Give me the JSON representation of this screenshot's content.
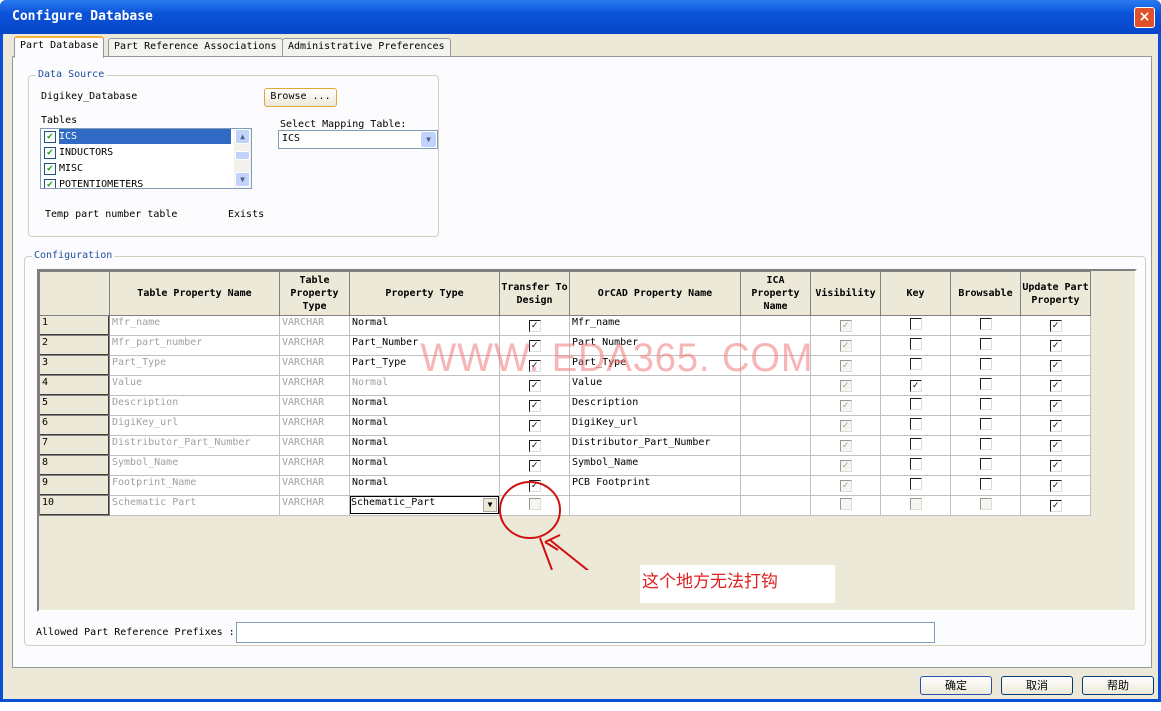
{
  "window": {
    "title": "Configure Database",
    "close": "×"
  },
  "tabs": [
    "Part Database",
    "Part Reference Associations",
    "Administrative Preferences"
  ],
  "data_source": {
    "label": "Data Source",
    "db_name": "Digikey_Database",
    "browse": "Browse ...",
    "tables_label": "Tables",
    "tables": [
      {
        "name": "ICS",
        "checked": true,
        "selected": true
      },
      {
        "name": "INDUCTORS",
        "checked": true
      },
      {
        "name": "MISC",
        "checked": true
      },
      {
        "name": "POTENTIOMETERS",
        "checked": true
      }
    ],
    "mapping_label": "Select Mapping Table:",
    "mapping_value": "ICS",
    "temp_label": "Temp part number table",
    "temp_status": "Exists"
  },
  "configuration": {
    "label": "Configuration",
    "columns": [
      "",
      "Table Property Name",
      "Table Property Type",
      "Property Type",
      "Transfer To Design",
      "OrCAD Property Name",
      "ICA Property Name",
      "Visibility",
      "Key",
      "Browsable",
      "Update Part Property"
    ],
    "rows": [
      {
        "n": "1",
        "name": "Mfr_name",
        "type": "VARCHAR",
        "ptype": "Normal",
        "transfer": true,
        "orcad": "Mfr_name",
        "ica": "",
        "vis": true,
        "key": false,
        "brows": false,
        "update": true
      },
      {
        "n": "2",
        "name": "Mfr_part_number",
        "type": "VARCHAR",
        "ptype": "Part_Number",
        "transfer": true,
        "orcad": "Part Number",
        "ica": "",
        "vis": true,
        "key": false,
        "brows": false,
        "update": true
      },
      {
        "n": "3",
        "name": "Part_Type",
        "type": "VARCHAR",
        "ptype": "Part_Type",
        "transfer": true,
        "orcad": "Part_Type",
        "ica": "",
        "vis": true,
        "key": false,
        "brows": false,
        "update": true
      },
      {
        "n": "4",
        "name": "Value",
        "type": "VARCHAR",
        "ptype": "Normal",
        "ptype_dim": true,
        "transfer": true,
        "orcad": "Value",
        "ica": "",
        "vis": true,
        "key": true,
        "brows": false,
        "update": true
      },
      {
        "n": "5",
        "name": "Description",
        "type": "VARCHAR",
        "ptype": "Normal",
        "transfer": true,
        "orcad": "Description",
        "ica": "",
        "vis": true,
        "key": false,
        "brows": false,
        "update": true
      },
      {
        "n": "6",
        "name": "DigiKey_url",
        "type": "VARCHAR",
        "ptype": "Normal",
        "transfer": true,
        "orcad": "DigiKey_url",
        "ica": "",
        "vis": true,
        "key": false,
        "brows": false,
        "update": true
      },
      {
        "n": "7",
        "name": "Distributor_Part_Number",
        "type": "VARCHAR",
        "ptype": "Normal",
        "transfer": true,
        "orcad": "Distributor_Part_Number",
        "ica": "",
        "vis": true,
        "key": false,
        "brows": false,
        "update": true
      },
      {
        "n": "8",
        "name": "Symbol_Name",
        "type": "VARCHAR",
        "ptype": "Normal",
        "transfer": true,
        "orcad": "Symbol_Name",
        "ica": "",
        "vis": true,
        "key": false,
        "brows": false,
        "update": true
      },
      {
        "n": "9",
        "name": "Footprint_Name",
        "type": "VARCHAR",
        "ptype": "Normal",
        "transfer": true,
        "orcad": "PCB Footprint",
        "ica": "",
        "vis": true,
        "key": false,
        "brows": false,
        "update": true
      },
      {
        "n": "10",
        "name": "Schematic Part",
        "type": "VARCHAR",
        "ptype": "Schematic_Part",
        "ptype_dropdown": true,
        "transfer": false,
        "transfer_disabled": true,
        "orcad": "",
        "ica": "",
        "vis": false,
        "key": false,
        "brows": false,
        "update": true
      }
    ],
    "prefix_label": "Allowed Part Reference Prefixes :",
    "prefix_value": ""
  },
  "buttons": {
    "ok": "确定",
    "cancel": "取消",
    "help": "帮助"
  },
  "watermark": "WWW. EDA365. COM",
  "annotation": "这个地方无法打钩"
}
